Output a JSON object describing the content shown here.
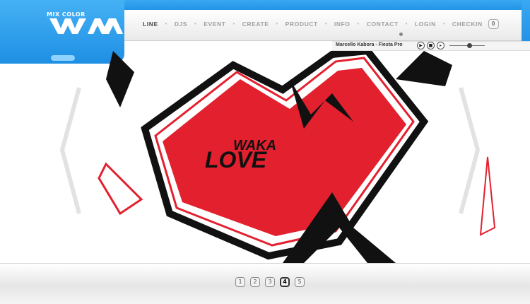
{
  "brand": {
    "tagline": "MIX COLOR",
    "mark": "WM"
  },
  "nav": {
    "items": [
      {
        "label": "LINE",
        "active": true
      },
      {
        "label": "DJS",
        "active": false
      },
      {
        "label": "EVENT",
        "active": false
      },
      {
        "label": "CREATE",
        "active": false
      },
      {
        "label": "PRODUCT",
        "active": false
      },
      {
        "label": "INFO",
        "active": false
      },
      {
        "label": "CONTACT",
        "active": false
      },
      {
        "label": "LOGIN",
        "active": false
      },
      {
        "label": "CHECKIN",
        "active": false
      }
    ],
    "checkin_count": "0"
  },
  "player": {
    "track": "Marcello Kabora - Fiesta Pro",
    "play_icon": "play-icon",
    "stop_icon": "stop-icon",
    "next_icon": "next-icon",
    "volume_level": 0.55
  },
  "slide": {
    "headline_top": "WAKA",
    "headline_main": "LOVE",
    "heart_color": "#e3202e"
  },
  "pager": {
    "pages": [
      "1",
      "2",
      "3",
      "4",
      "5"
    ],
    "current": "4"
  },
  "colors": {
    "accent_blue": "#2294e6",
    "heart_red": "#e3202e",
    "ink": "#111111"
  }
}
